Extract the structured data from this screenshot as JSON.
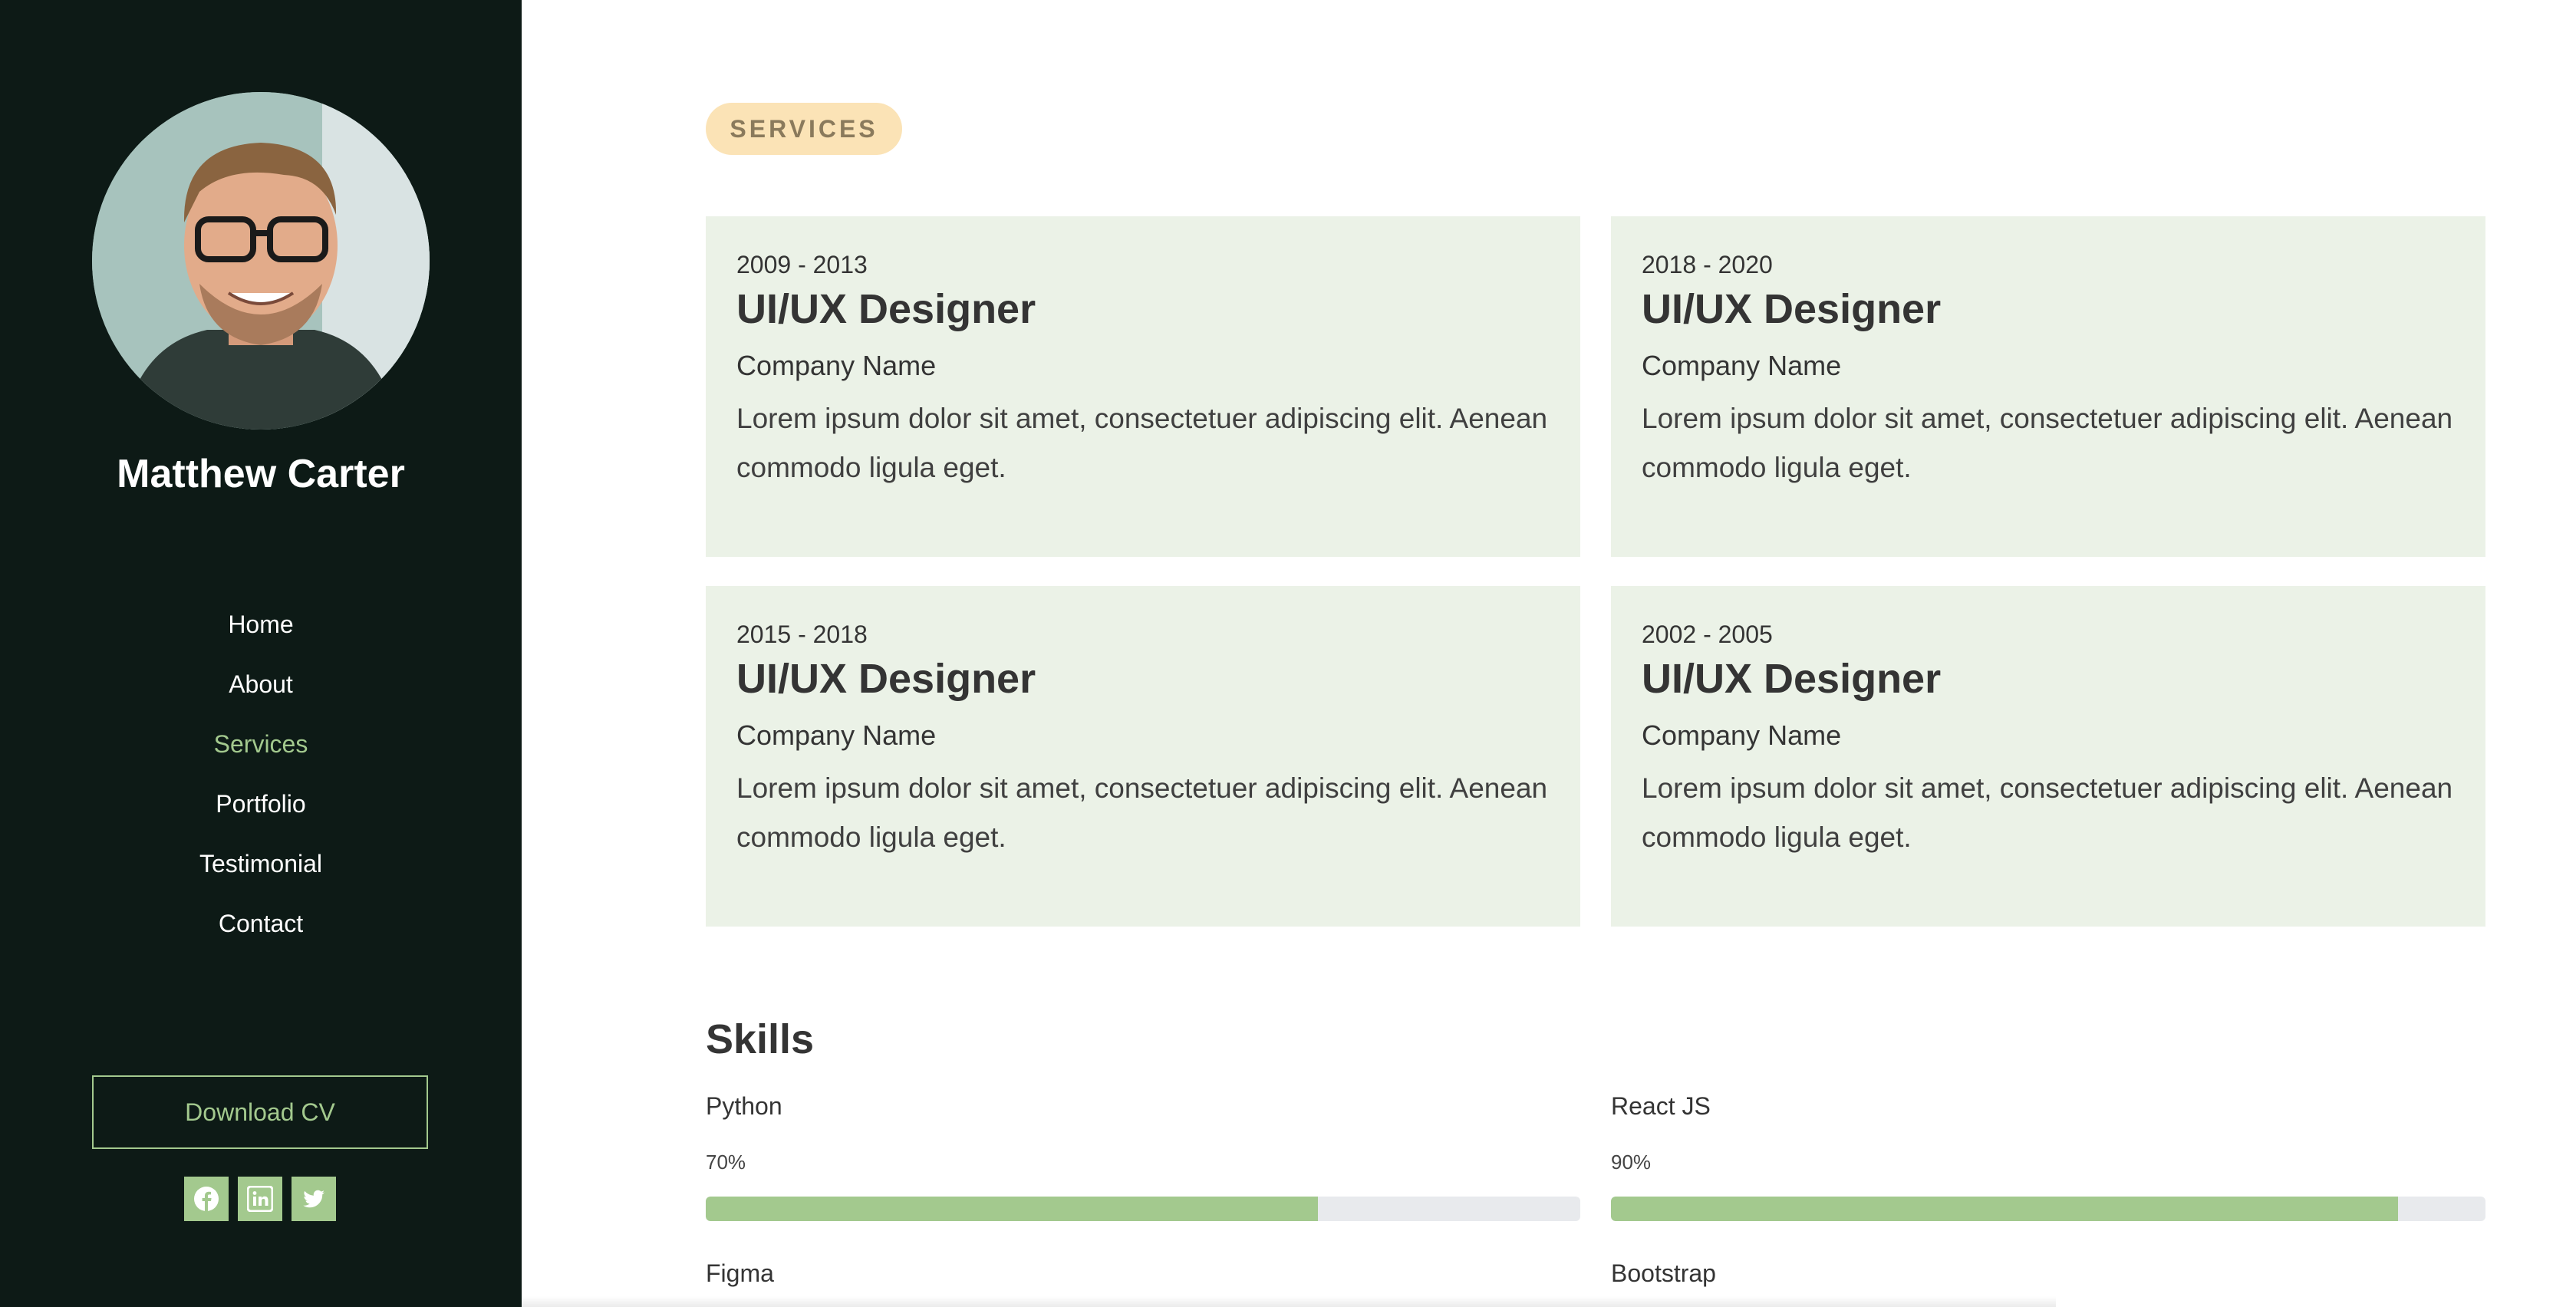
{
  "sidebar": {
    "name": "Matthew Carter",
    "nav": [
      "Home",
      "About",
      "Services",
      "Portfolio",
      "Testimonial",
      "Contact"
    ],
    "active_nav": "Services",
    "download_cv": "Download CV",
    "socials": [
      "facebook-icon",
      "linkedin-icon",
      "twitter-icon"
    ]
  },
  "services": {
    "badge": "SERVICES",
    "cards": [
      {
        "years": "2009 - 2013",
        "title": "UI/UX Designer",
        "company": "Company Name",
        "desc": "Lorem ipsum dolor sit amet, consectetuer adipiscing elit. Aenean commodo ligula eget."
      },
      {
        "years": "2018 - 2020",
        "title": "UI/UX Designer",
        "company": "Company Name",
        "desc": "Lorem ipsum dolor sit amet, consectetuer adipiscing elit. Aenean commodo ligula eget."
      },
      {
        "years": "2015 - 2018",
        "title": "UI/UX Designer",
        "company": "Company Name",
        "desc": "Lorem ipsum dolor sit amet, consectetuer adipiscing elit. Aenean commodo ligula eget."
      },
      {
        "years": "2002 - 2005",
        "title": "UI/UX Designer",
        "company": "Company Name",
        "desc": "Lorem ipsum dolor sit amet, consectetuer adipiscing elit. Aenean commodo ligula eget."
      }
    ]
  },
  "skills": {
    "title": "Skills",
    "items": [
      {
        "name": "Python",
        "percent_label": "70%",
        "level": 0.7
      },
      {
        "name": "React JS",
        "percent_label": "90%",
        "level": 0.9
      },
      {
        "name": "Figma"
      },
      {
        "name": "Bootstrap"
      }
    ]
  },
  "colors": {
    "sidebar_bg": "#0d1a16",
    "accent": "#a3c98e",
    "card_bg": "#ebf2e7",
    "badge_bg": "#fbe3b6"
  }
}
